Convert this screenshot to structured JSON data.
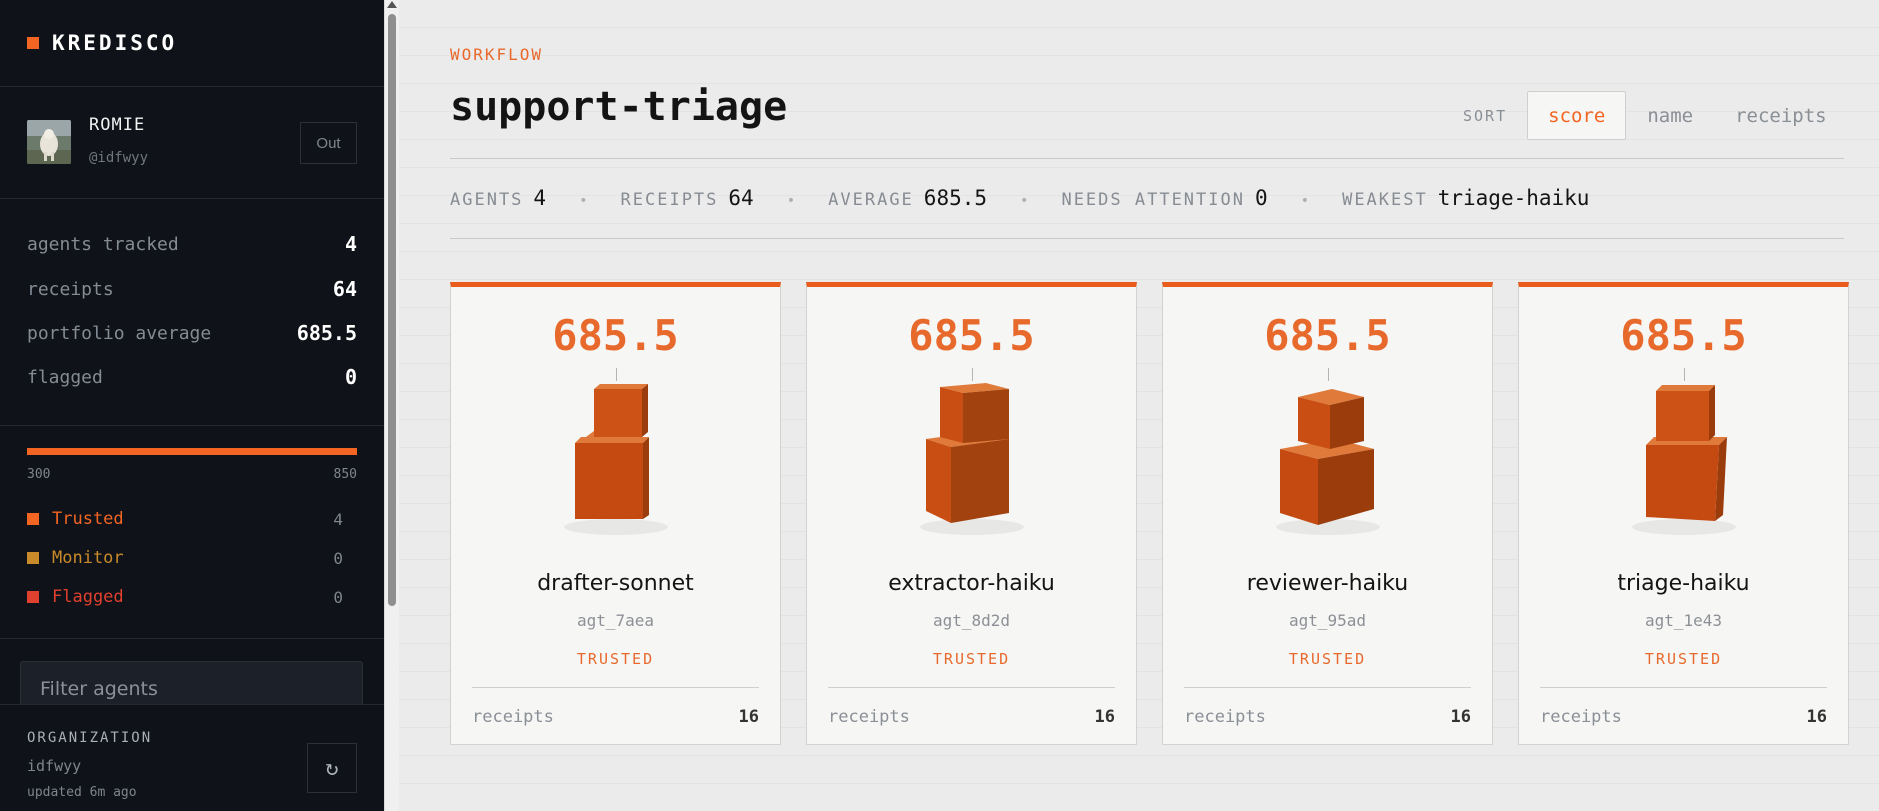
{
  "brand": {
    "name": "KREDISCO",
    "accent": "#f26522"
  },
  "user": {
    "name": "ROMIE",
    "handle": "@idfwyy",
    "logout_label": "Out"
  },
  "stats": [
    {
      "label": "agents tracked",
      "value": "4"
    },
    {
      "label": "receipts",
      "value": "64"
    },
    {
      "label": "portfolio average",
      "value": "685.5"
    },
    {
      "label": "flagged",
      "value": "0"
    }
  ],
  "distribution": {
    "min": "300",
    "max": "850",
    "legend": [
      {
        "label": "Trusted",
        "count": "4",
        "color": "#f26522"
      },
      {
        "label": "Monitor",
        "count": "0",
        "color": "#c98a2a"
      },
      {
        "label": "Flagged",
        "count": "0",
        "color": "#e0402e"
      }
    ]
  },
  "filter": {
    "placeholder": "Filter agents"
  },
  "org": {
    "title": "ORGANIZATION",
    "name": "idfwyy",
    "updated": "updated 6m ago",
    "refresh_icon": "refresh-icon"
  },
  "main": {
    "eyebrow": "WORKFLOW",
    "title": "support-triage",
    "sort": {
      "label": "SORT",
      "options": [
        "score",
        "name",
        "receipts"
      ],
      "selected": "score"
    },
    "summary": [
      {
        "label": "AGENTS",
        "value": "4"
      },
      {
        "label": "RECEIPTS",
        "value": "64"
      },
      {
        "label": "AVERAGE",
        "value": "685.5"
      },
      {
        "label": "NEEDS ATTENTION",
        "value": "0"
      },
      {
        "label": "WEAKEST",
        "value": "triage-haiku"
      }
    ],
    "cards": [
      {
        "score": "685.5",
        "name": "drafter-sonnet",
        "id": "agt_7aea",
        "status": "TRUSTED",
        "receipts_label": "receipts",
        "receipts": "16"
      },
      {
        "score": "685.5",
        "name": "extractor-haiku",
        "id": "agt_8d2d",
        "status": "TRUSTED",
        "receipts_label": "receipts",
        "receipts": "16"
      },
      {
        "score": "685.5",
        "name": "reviewer-haiku",
        "id": "agt_95ad",
        "status": "TRUSTED",
        "receipts_label": "receipts",
        "receipts": "16"
      },
      {
        "score": "685.5",
        "name": "triage-haiku",
        "id": "agt_1e43",
        "status": "TRUSTED",
        "receipts_label": "receipts",
        "receipts": "16"
      }
    ]
  }
}
